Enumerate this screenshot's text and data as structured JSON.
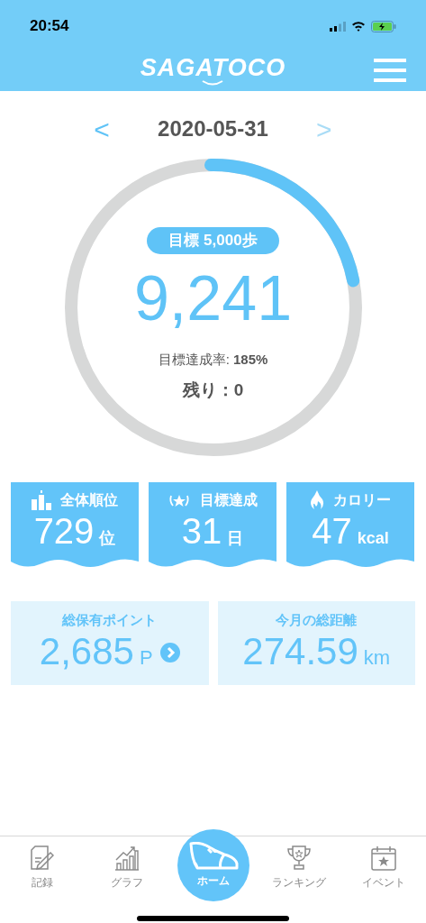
{
  "status_bar": {
    "time": "20:54"
  },
  "header": {
    "logo": "SAGATOCO"
  },
  "date_nav": {
    "prev": {
      "label": "<",
      "disabled": false
    },
    "date": "2020-05-31",
    "next": {
      "label": ">",
      "disabled": true
    }
  },
  "steps": {
    "goal_badge": "目標 5,000歩",
    "count": "9,241",
    "rate": "目標達成率: **185%**",
    "remaining": "残り：0"
  },
  "stat_cards": [
    {
      "kind": "rank",
      "title": "全体順位",
      "value": "729",
      "unit": "位"
    },
    {
      "kind": "goal",
      "title": "目標達成",
      "value": "31",
      "unit": "日"
    },
    {
      "kind": "calorie",
      "title": "カロリー",
      "value": "47",
      "unit": "kcal"
    }
  ],
  "summary_cards": [
    {
      "title": "総保有ポイント",
      "value": "2,685",
      "unit": "P",
      "link": true
    },
    {
      "title": "今月の総距離",
      "value": "274.59",
      "unit": "km",
      "link": false
    }
  ],
  "tab_bar": [
    {
      "kind": "record",
      "label": "記録",
      "selected": false
    },
    {
      "kind": "graph",
      "label": "グラフ",
      "selected": false
    },
    {
      "kind": "home",
      "label": "ホーム",
      "selected": true
    },
    {
      "kind": "ranking",
      "label": "ランキング",
      "selected": false
    },
    {
      "kind": "event",
      "label": "イベント",
      "selected": false
    }
  ]
}
